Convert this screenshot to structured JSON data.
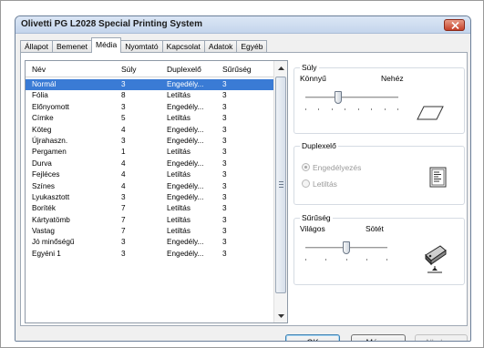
{
  "window": {
    "title": "Olivetti PG L2028 Special Printing System"
  },
  "tabs": [
    {
      "label": "Állapot"
    },
    {
      "label": "Bemenet"
    },
    {
      "label": "Média",
      "active": true
    },
    {
      "label": "Nyomtató"
    },
    {
      "label": "Kapcsolat"
    },
    {
      "label": "Adatok"
    },
    {
      "label": "Egyéb"
    }
  ],
  "media_table": {
    "columns": [
      "Név",
      "Súly",
      "Duplexelő",
      "Sűrűség"
    ],
    "rows": [
      [
        "Normál",
        "3",
        "Engedély...",
        "3"
      ],
      [
        "Fólia",
        "8",
        "Letiltás",
        "3"
      ],
      [
        "Előnyomott",
        "3",
        "Engedély...",
        "3"
      ],
      [
        "Címke",
        "5",
        "Letiltás",
        "3"
      ],
      [
        "Köteg",
        "4",
        "Engedély...",
        "3"
      ],
      [
        "Újrahaszn.",
        "3",
        "Engedély...",
        "3"
      ],
      [
        "Pergamen",
        "1",
        "Letiltás",
        "3"
      ],
      [
        "Durva",
        "4",
        "Engedély...",
        "3"
      ],
      [
        "Fejléces",
        "4",
        "Letiltás",
        "3"
      ],
      [
        "Színes",
        "4",
        "Engedély...",
        "3"
      ],
      [
        "Lyukasztott",
        "3",
        "Engedély...",
        "3"
      ],
      [
        "Boríték",
        "7",
        "Letiltás",
        "3"
      ],
      [
        "Kártyatömb",
        "7",
        "Letiltás",
        "3"
      ],
      [
        "Vastag",
        "7",
        "Letiltás",
        "3"
      ],
      [
        "Jó minőségű",
        "3",
        "Engedély...",
        "3"
      ],
      [
        "Egyéni 1",
        "3",
        "Engedély...",
        "3"
      ]
    ],
    "selected_index": 0
  },
  "suly_group": {
    "label": "Súly",
    "min_label": "Könnyű",
    "max_label": "Nehéz",
    "value_fraction": 0.35
  },
  "duplex_group": {
    "label": "Duplexelő",
    "options": [
      "Engedélyezés",
      "Letiltás"
    ],
    "selected": 0
  },
  "density_group": {
    "label": "Sűrűség",
    "min_label": "Világos",
    "max_label": "Sötét",
    "value_fraction": 0.5
  },
  "buttons": {
    "ok": "OK",
    "cancel": "Mégse",
    "apply": "Alkalmaz"
  }
}
